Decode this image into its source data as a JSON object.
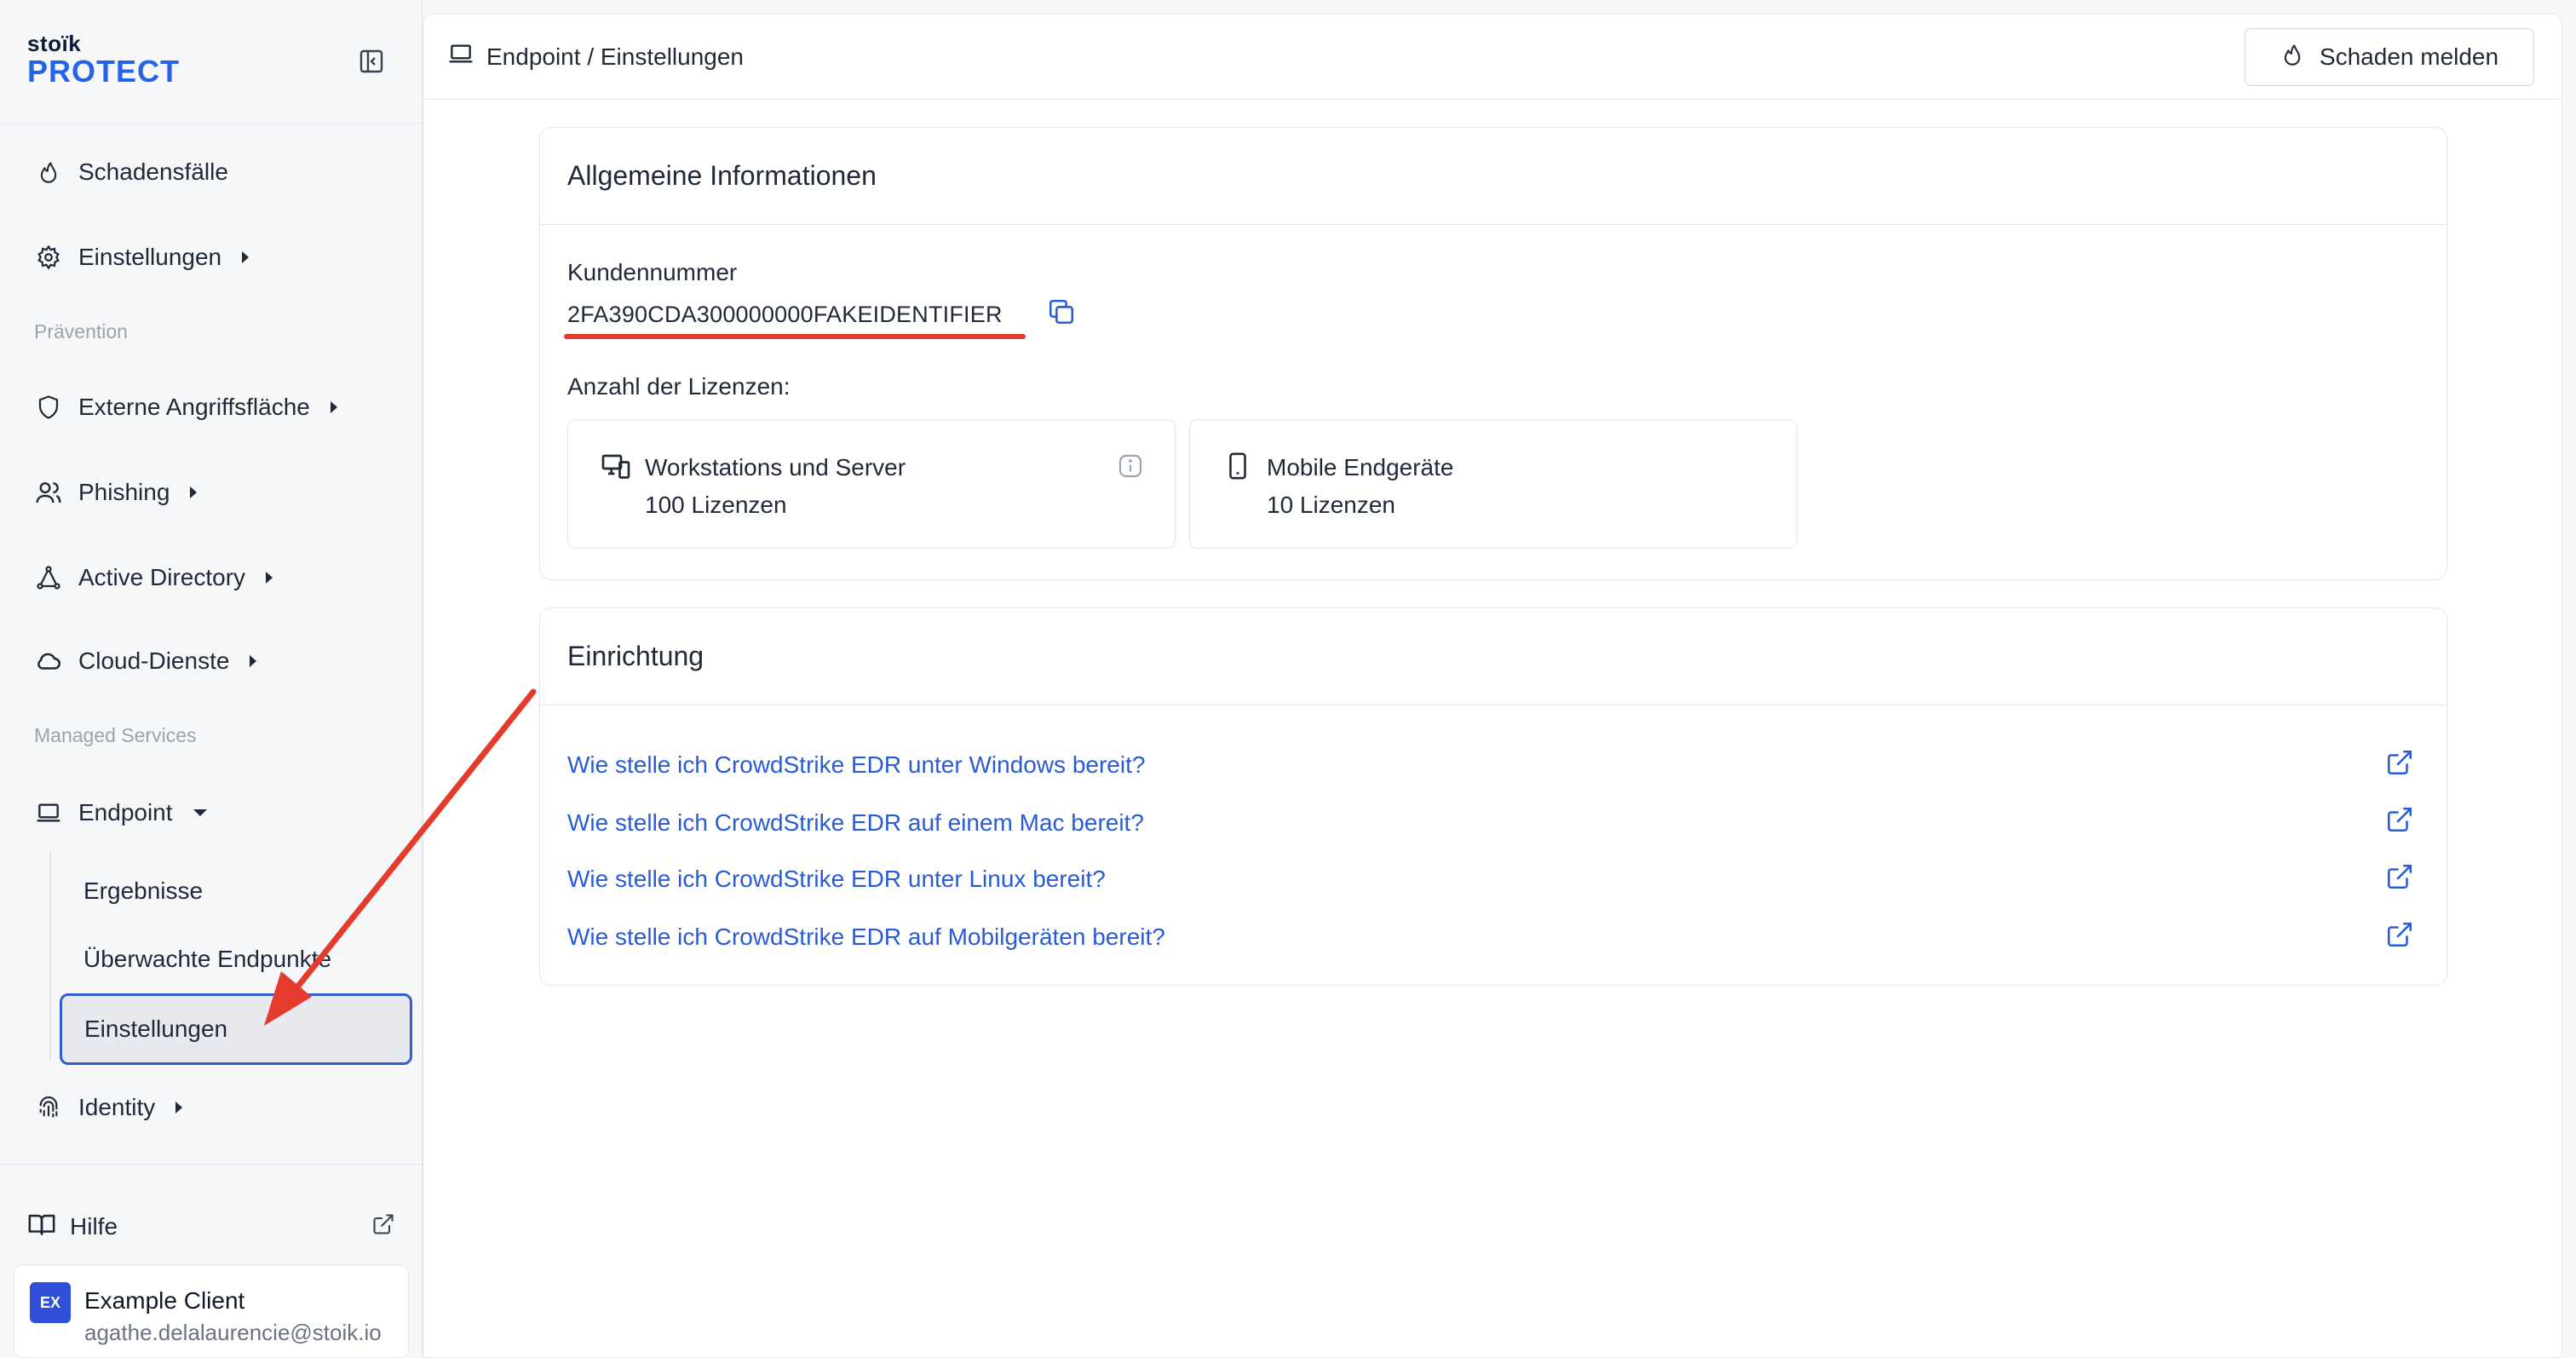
{
  "brand": {
    "small": "stoïk",
    "big": "PROTECT"
  },
  "sidebar": {
    "items": [
      {
        "label": "Schadensfälle",
        "icon": "flame-icon"
      },
      {
        "label": "Einstellungen",
        "icon": "gear-icon"
      },
      {
        "label": "Externe Angriffsfläche",
        "icon": "shield-icon"
      },
      {
        "label": "Phishing",
        "icon": "users-icon"
      },
      {
        "label": "Active Directory",
        "icon": "network-icon"
      },
      {
        "label": "Cloud-Dienste",
        "icon": "cloud-icon"
      },
      {
        "label": "Endpoint",
        "icon": "laptop-icon"
      },
      {
        "label": "Identity",
        "icon": "fingerprint-icon"
      }
    ],
    "sections": {
      "praevention": "Prävention",
      "managed": "Managed Services"
    },
    "endpoint_sub": [
      "Ergebnisse",
      "Überwachte Endpunkte",
      "Einstellungen"
    ],
    "help": "Hilfe",
    "client": {
      "avatar": "EX",
      "name": "Example Client",
      "email": "agathe.delalaurencie@stoik.io"
    }
  },
  "header": {
    "breadcrumb": "Endpoint / Einstellungen",
    "report_button": "Schaden melden"
  },
  "general": {
    "title": "Allgemeine Informationen",
    "customer_number_label": "Kundennummer",
    "customer_number": "2FA390CDA300000000FAKEIDENTIFIER",
    "licenses_label": "Anzahl der Lizenzen:",
    "licenses": [
      {
        "title": "Workstations und Server",
        "count": "100 Lizenzen"
      },
      {
        "title": "Mobile Endgeräte",
        "count": "10 Lizenzen"
      }
    ]
  },
  "setup": {
    "title": "Einrichtung",
    "links": [
      "Wie stelle ich CrowdStrike EDR unter Windows bereit?",
      "Wie stelle ich CrowdStrike EDR auf einem Mac bereit?",
      "Wie stelle ich CrowdStrike EDR unter Linux bereit?",
      "Wie stelle ich CrowdStrike EDR auf Mobilgeräten bereit?"
    ]
  },
  "colors": {
    "accent": "#2563eb",
    "link": "#2a5bd7",
    "annotation": "#e43b2c",
    "active_border": "#2f5fd0"
  }
}
